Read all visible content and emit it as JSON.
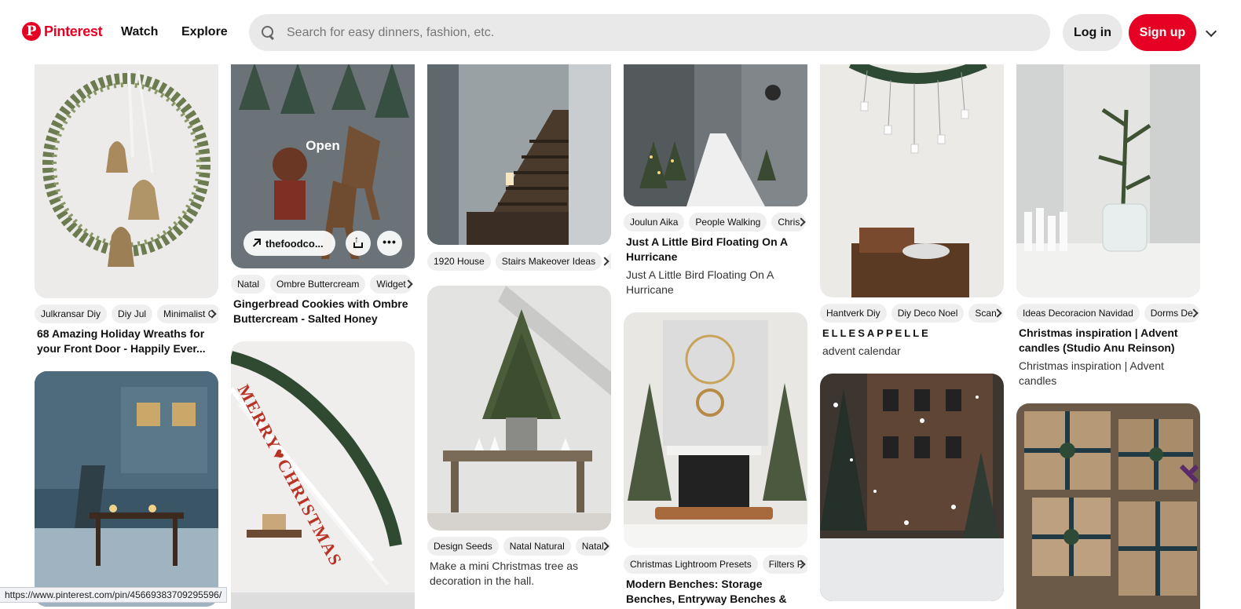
{
  "header": {
    "logo_text": "Pinterest",
    "logo_glyph": "P",
    "nav": [
      "Watch",
      "Explore"
    ],
    "search_placeholder": "Search for easy dinners, fashion, etc.",
    "login_label": "Log in",
    "signup_label": "Sign up",
    "brand_color": "#e60023"
  },
  "pins": [
    {
      "tags": [
        "Julkransar Diy",
        "Diy Jul",
        "Minimalist C"
      ],
      "title": "68 Amazing Holiday Wreaths for your Front Door - Happily Ever...",
      "image": "wreath with brass bells on white door"
    },
    {
      "tags": [],
      "title": "",
      "image": "snowy courtyard with outdoor table at dusk"
    },
    {
      "tags": [
        "Natal",
        "Ombre Buttercream",
        "Widget"
      ],
      "title": "Gingerbread Cookies with Ombre Buttercream - Salted Honey",
      "image": "gingerbread cookies trees santa reindeer",
      "overlay": {
        "open_label": "Open",
        "link_label": "thefoodco..."
      }
    },
    {
      "tags": [],
      "title": "",
      "image": "staircase garland merry christmas banner"
    },
    {
      "tags": [
        "1920 House",
        "Stairs Makeover Ideas",
        "C"
      ],
      "title": "",
      "image": "dark wooden stairs with candles"
    },
    {
      "tags": [
        "Design Seeds",
        "Natal Natural",
        "Natal"
      ],
      "subtitle": "Make a mini Christmas tree as decoration in the hall.",
      "image": "mini christmas tree on bench in hall"
    },
    {
      "tags": [
        "Joulun Aika",
        "People Walking",
        "Chris"
      ],
      "title": "Just A Little Bird Floating On A Hurricane",
      "subtitle": "Just A Little Bird Floating On A Hurricane",
      "image": "snowy street with christmas trees"
    },
    {
      "tags": [
        "Christmas Lightroom Presets",
        "Filters P"
      ],
      "title": "Modern Benches: Storage Benches, Entryway Benches & Bedroom...",
      "image": "fireplace with two christmas trees and bench"
    },
    {
      "tags": [
        "Hantverk Diy",
        "Diy Deco Noel",
        "Scan"
      ],
      "brand": "ELLESAPPELLE",
      "subtitle": "advent calendar",
      "image": "advent calendar hanging from branch"
    },
    {
      "tags": [],
      "title": "",
      "image": "snowy brick building and trees"
    },
    {
      "tags": [
        "Ideas Decoracion Navidad",
        "Dorms De"
      ],
      "title": "Christmas inspiration | Advent candles (Studio Anu Reinson)",
      "subtitle": "Christmas inspiration | Advent candles",
      "image": "pine branch in jar with white candles"
    },
    {
      "tags": [],
      "title": "",
      "image": "kraft paper gifts with ribbons"
    }
  ],
  "status_url": "https://www.pinterest.com/pin/456693837092955​96/"
}
